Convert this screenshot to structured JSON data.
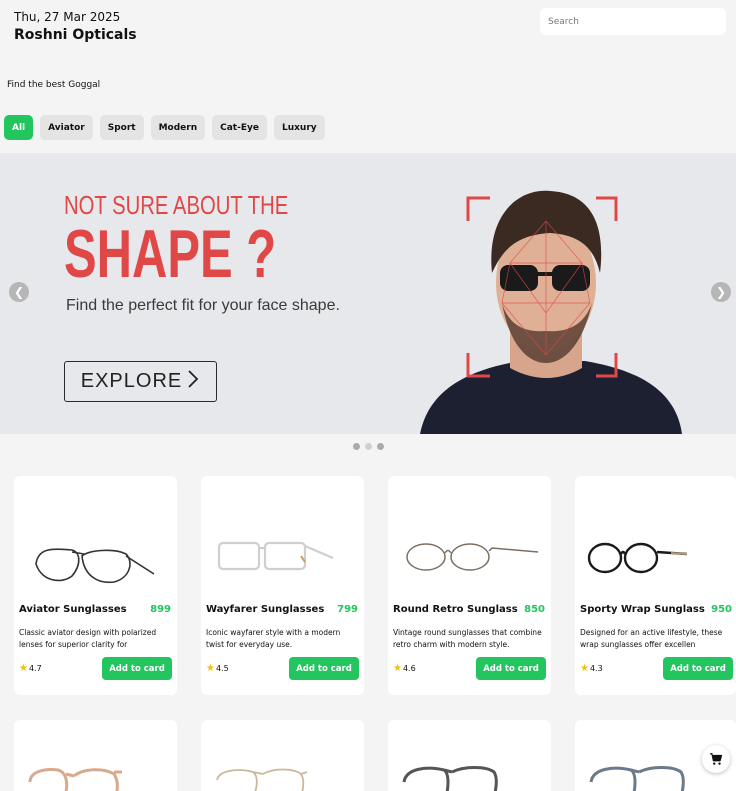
{
  "header": {
    "date": "Thu, 27 Mar 2025",
    "store_name": "Roshni Opticals",
    "search_placeholder": "Search",
    "tagline": "Find the best Goggal"
  },
  "filters": [
    "All",
    "Aviator",
    "Sport",
    "Modern",
    "Cat-Eye",
    "Luxury"
  ],
  "active_filter": "All",
  "banner": {
    "line1": "NOT SURE ABOUT THE",
    "line2": "SHAPE ?",
    "subtitle": "Find the perfect fit for your face shape.",
    "button": "EXPLORE",
    "active_slide": 1,
    "slide_count": 3
  },
  "products": [
    {
      "name": "Aviator Sunglasses",
      "price": "899",
      "description": "Classic aviator design with polarized lenses for superior clarity for",
      "rating": "4.7",
      "button": "Add to card",
      "frame_color": "#333333"
    },
    {
      "name": "Wayfarer Sunglasses",
      "price": "799",
      "description": "Iconic wayfarer style with a modern twist for everyday use.",
      "rating": "4.5",
      "button": "Add to card",
      "frame_color": "#d8d8d8"
    },
    {
      "name": "Round Retro Sunglass",
      "price": "850",
      "description": "Vintage round sunglasses that combine retro charm with modern style.",
      "rating": "4.6",
      "button": "Add to card",
      "frame_color": "#8a8070"
    },
    {
      "name": "Sporty Wrap Sunglass",
      "price": "950",
      "description": "Designed for an active lifestyle, these wrap sunglasses offer excellen",
      "rating": "4.3",
      "button": "Add to card",
      "frame_color": "#1a1a1a"
    }
  ],
  "second_row_frame_colors": [
    "#d9a98c",
    "#c9b89a",
    "#555555",
    "#6a7a8a"
  ],
  "colors": {
    "accent": "#22c55e",
    "banner_red": "#e04848"
  }
}
